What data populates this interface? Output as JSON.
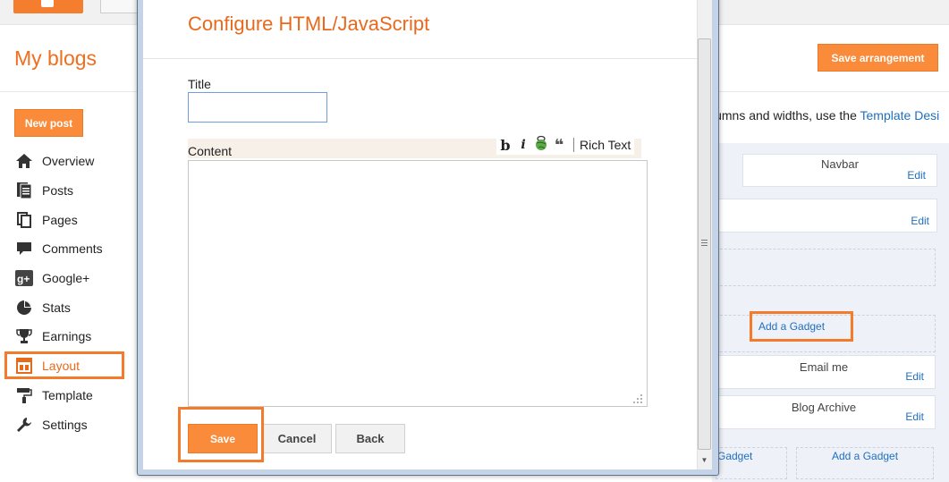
{
  "page": {
    "title": "My blogs",
    "new_post": "New post",
    "save_arrangement": "Save arrangement",
    "layout_hint_text": "lumns and widths, use the ",
    "layout_hint_link": "Template Desi"
  },
  "sidebar": {
    "items": [
      {
        "label": "Overview",
        "icon": "home-icon"
      },
      {
        "label": "Posts",
        "icon": "posts-icon"
      },
      {
        "label": "Pages",
        "icon": "pages-icon"
      },
      {
        "label": "Comments",
        "icon": "comments-icon"
      },
      {
        "label": "Google+",
        "icon": "google-plus-icon"
      },
      {
        "label": "Stats",
        "icon": "stats-icon"
      },
      {
        "label": "Earnings",
        "icon": "trophy-icon"
      },
      {
        "label": "Layout",
        "icon": "layout-icon",
        "active": true
      },
      {
        "label": "Template",
        "icon": "paint-roller-icon"
      },
      {
        "label": "Settings",
        "icon": "wrench-icon"
      }
    ]
  },
  "layout": {
    "navbar": "Navbar",
    "edit": "Edit",
    "add_gadget": "Add a Gadget",
    "email_me": "Email me",
    "blog_archive": "Blog Archive",
    "add_gadget_partial": "Gadget"
  },
  "dialog": {
    "title": "Configure HTML/JavaScript",
    "title_label": "Title",
    "title_value": "",
    "content_label": "Content",
    "content_value": "",
    "toolbar": {
      "bold": "b",
      "italic": "i",
      "quote": "❝",
      "rich_text": "Rich Text"
    },
    "save": "Save",
    "cancel": "Cancel",
    "back": "Back"
  },
  "colors": {
    "accent": "#f98b3a",
    "title_orange": "#e8691c",
    "highlight": "#f47b2c",
    "link": "#1f6fbf"
  }
}
